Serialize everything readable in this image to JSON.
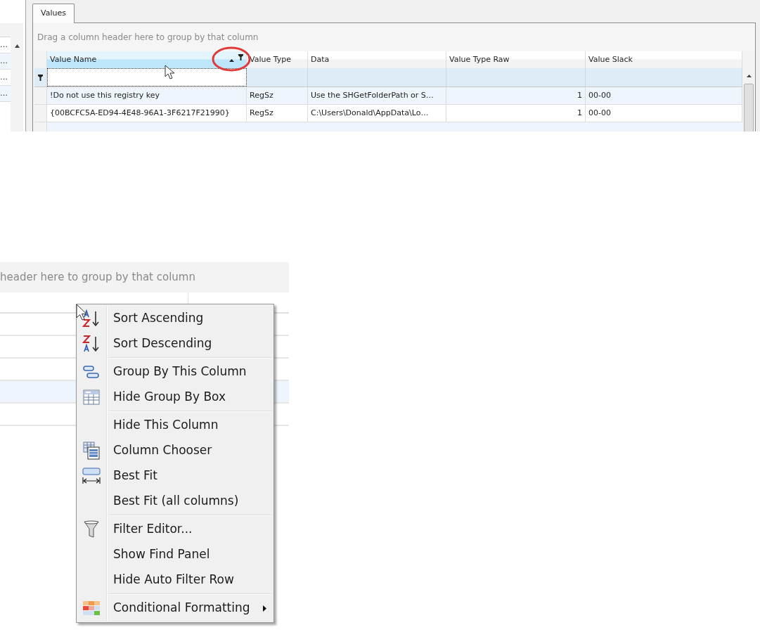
{
  "left_grid": {
    "rows": [
      "…",
      "…",
      "…",
      "…"
    ]
  },
  "tabs": [
    {
      "label": "Values",
      "selected": true
    }
  ],
  "group_panel": {
    "hint": "Drag a column header here to group by that column"
  },
  "table": {
    "columns": [
      {
        "label": "Value Name",
        "selected": true,
        "sorted": true
      },
      {
        "label": "Value Type",
        "selected": false,
        "sorted": false
      },
      {
        "label": "Data",
        "selected": false,
        "sorted": false
      },
      {
        "label": "Value Type Raw",
        "selected": false,
        "sorted": false
      },
      {
        "label": "Value Slack",
        "selected": false,
        "sorted": false
      }
    ],
    "rows": [
      [
        "!Do not use this registry key",
        "RegSz",
        "Use the SHGetFolderPath or S…",
        "1",
        "00-00"
      ],
      [
        "{00BCFC5A-ED94-4E48-96A1-3F6217F21990}",
        "RegSz",
        "C:\\Users\\Donald\\AppData\\Lo…",
        "1",
        "00-00"
      ]
    ]
  },
  "zoomed": {
    "group_panel": {
      "hint": "header here to group by that column"
    },
    "rows": [
      {
        "selected": false
      },
      {
        "selected": false
      },
      {
        "selected": false
      },
      {
        "selected": true
      },
      {
        "selected": false
      }
    ],
    "context_menu": [
      {
        "label": "Sort Ascending",
        "separator_before": false,
        "has_submenu": false
      },
      {
        "label": "Sort Descending",
        "separator_before": false,
        "has_submenu": false
      },
      {
        "label": "Group By This Column",
        "separator_before": true,
        "has_submenu": false
      },
      {
        "label": "Hide Group By Box",
        "separator_before": false,
        "has_submenu": false
      },
      {
        "label": "Hide This Column",
        "separator_before": true,
        "has_submenu": false
      },
      {
        "label": "Column Chooser",
        "separator_before": false,
        "has_submenu": false
      },
      {
        "label": "Best Fit",
        "separator_before": false,
        "has_submenu": false
      },
      {
        "label": "Best Fit (all columns)",
        "separator_before": false,
        "has_submenu": false
      },
      {
        "label": "Filter Editor...",
        "separator_before": true,
        "has_submenu": false
      },
      {
        "label": "Show Find Panel",
        "separator_before": false,
        "has_submenu": false
      },
      {
        "label": "Hide Auto Filter Row",
        "separator_before": false,
        "has_submenu": false
      },
      {
        "label": "Conditional Formatting",
        "separator_before": true,
        "has_submenu": true
      }
    ]
  }
}
